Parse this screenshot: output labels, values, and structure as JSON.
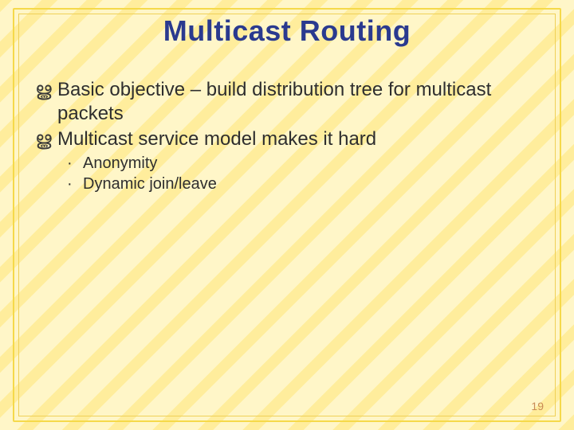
{
  "title": "Multicast Routing",
  "bullets": {
    "b1": "Basic objective – build distribution tree for multicast packets",
    "b2": "Multicast service model makes it hard",
    "b2a": "Anonymity",
    "b2b": "Dynamic join/leave"
  },
  "glyphs": {
    "swirl": "ൠ",
    "dot": "·"
  },
  "page_number": "19"
}
